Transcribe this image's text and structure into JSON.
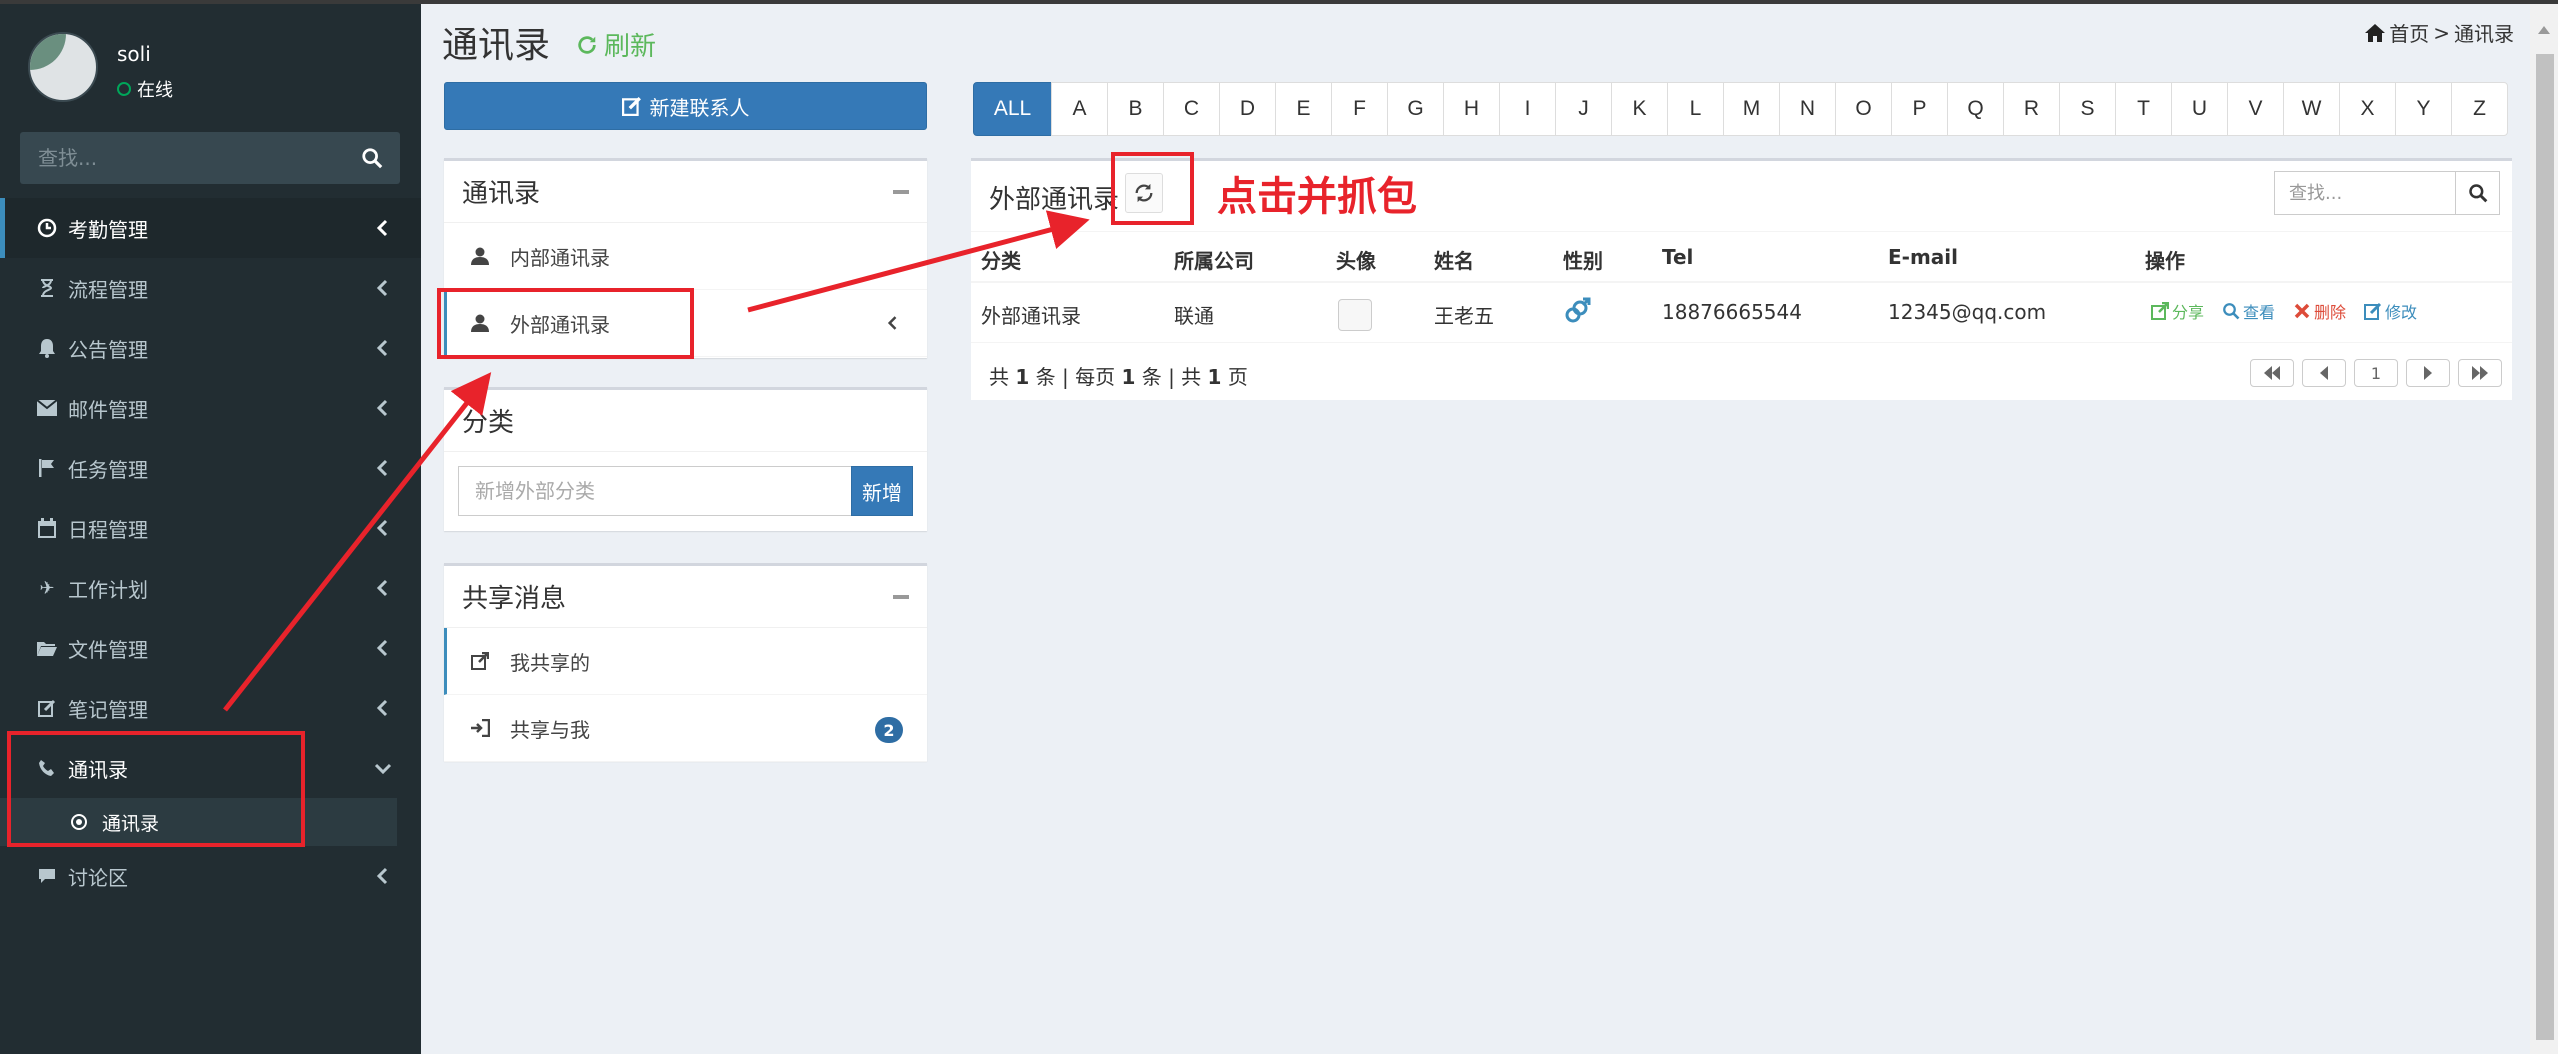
{
  "user": {
    "name": "soli",
    "status": "在线"
  },
  "sidebar": {
    "search_placeholder": "查找...",
    "items": [
      {
        "label": "考勤管理",
        "icon": "clock-icon",
        "active": true
      },
      {
        "label": "流程管理",
        "icon": "hourglass-icon"
      },
      {
        "label": "公告管理",
        "icon": "bell-icon"
      },
      {
        "label": "邮件管理",
        "icon": "envelope-icon"
      },
      {
        "label": "任务管理",
        "icon": "flag-icon"
      },
      {
        "label": "日程管理",
        "icon": "calendar-icon"
      },
      {
        "label": "工作计划",
        "icon": "plane-icon"
      },
      {
        "label": "文件管理",
        "icon": "folder-icon"
      },
      {
        "label": "笔记管理",
        "icon": "edit-icon"
      },
      {
        "label": "通讯录",
        "icon": "phone-icon",
        "open": true
      },
      {
        "label": "讨论区",
        "icon": "comment-icon"
      }
    ],
    "sub_item": "通讯录"
  },
  "header": {
    "title": "通讯录",
    "refresh": "刷新",
    "breadcrumb_home": "首页",
    "breadcrumb_sep": ">",
    "breadcrumb_current": "通讯录"
  },
  "left": {
    "new_contact": "新建联系人",
    "addressbook": {
      "title": "通讯录",
      "items": [
        "内部通讯录",
        "外部通讯录"
      ]
    },
    "category": {
      "title": "分类",
      "placeholder": "新增外部分类",
      "add_button": "新增"
    },
    "share": {
      "title": "共享消息",
      "items": [
        "我共享的",
        "共享与我"
      ],
      "badge": "2"
    }
  },
  "letters": [
    "ALL",
    "A",
    "B",
    "C",
    "D",
    "E",
    "F",
    "G",
    "H",
    "I",
    "J",
    "K",
    "L",
    "M",
    "N",
    "O",
    "P",
    "Q",
    "R",
    "S",
    "T",
    "U",
    "V",
    "W",
    "X",
    "Y",
    "Z"
  ],
  "table": {
    "title": "外部通讯录",
    "search_placeholder": "查找...",
    "columns": [
      "分类",
      "所属公司",
      "头像",
      "姓名",
      "性别",
      "Tel",
      "E-mail",
      "操作"
    ],
    "rows": [
      {
        "category": "外部通讯录",
        "company": "联通",
        "name": "王老五",
        "tel": "18876665544",
        "email": "12345@qq.com"
      }
    ],
    "actions": [
      "分享",
      "查看",
      "删除",
      "修改"
    ],
    "pager": {
      "total_pre": "共",
      "total": "1",
      "total_mid": "条 | 每页",
      "per_page": "1",
      "per_mid": "条 | 共",
      "pages": "1",
      "pages_post": "页",
      "current": "1"
    }
  },
  "annotation": {
    "text": "点击并抓包",
    "color": "#e8232b"
  },
  "colors": {
    "sidebar": "#222d32",
    "primary": "#3579b7",
    "success": "#5cb85c",
    "danger": "#dd4b39"
  }
}
